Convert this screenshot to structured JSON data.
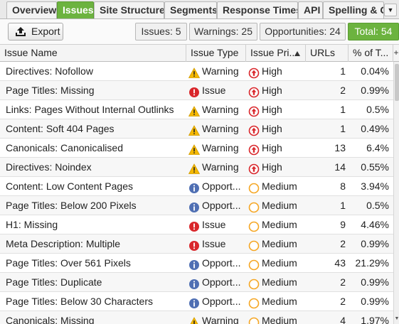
{
  "tabs": [
    {
      "label": "Overview",
      "active": false
    },
    {
      "label": "Issues",
      "active": true
    },
    {
      "label": "Site Structure",
      "active": false
    },
    {
      "label": "Segments",
      "active": false
    },
    {
      "label": "Response Times",
      "active": false
    },
    {
      "label": "API",
      "active": false
    },
    {
      "label": "Spelling & Gr",
      "active": false
    }
  ],
  "toolbar": {
    "export_label": "Export",
    "filters": {
      "issues": "Issues: 5",
      "warnings": "Warnings: 25",
      "opportunities": "Opportunities: 24",
      "total": "Total: 54"
    }
  },
  "table": {
    "headers": [
      "Issue Name",
      "Issue Type",
      "Issue Pri...",
      "URLs",
      "% of T..."
    ],
    "rows": [
      {
        "name": "Directives: Nofollow",
        "type": "Warning",
        "type_icon": "warning-icon",
        "priority": "High",
        "priority_icon": "high-priority-icon",
        "urls": "1",
        "pct": "0.04%"
      },
      {
        "name": "Page Titles: Missing",
        "type": "Issue",
        "type_icon": "issue-icon",
        "priority": "High",
        "priority_icon": "high-priority-icon",
        "urls": "2",
        "pct": "0.99%"
      },
      {
        "name": "Links: Pages Without Internal Outlinks",
        "type": "Warning",
        "type_icon": "warning-icon",
        "priority": "High",
        "priority_icon": "high-priority-icon",
        "urls": "1",
        "pct": "0.5%"
      },
      {
        "name": "Content: Soft 404 Pages",
        "type": "Warning",
        "type_icon": "warning-icon",
        "priority": "High",
        "priority_icon": "high-priority-icon",
        "urls": "1",
        "pct": "0.49%"
      },
      {
        "name": "Canonicals: Canonicalised",
        "type": "Warning",
        "type_icon": "warning-icon",
        "priority": "High",
        "priority_icon": "high-priority-icon",
        "urls": "13",
        "pct": "6.4%"
      },
      {
        "name": "Directives: Noindex",
        "type": "Warning",
        "type_icon": "warning-icon",
        "priority": "High",
        "priority_icon": "high-priority-icon",
        "urls": "14",
        "pct": "0.55%"
      },
      {
        "name": "Content: Low Content Pages",
        "type": "Opport...",
        "type_icon": "opportunity-icon",
        "priority": "Medium",
        "priority_icon": "medium-priority-icon",
        "urls": "8",
        "pct": "3.94%"
      },
      {
        "name": "Page Titles: Below 200 Pixels",
        "type": "Opport...",
        "type_icon": "opportunity-icon",
        "priority": "Medium",
        "priority_icon": "medium-priority-icon",
        "urls": "1",
        "pct": "0.5%"
      },
      {
        "name": "H1: Missing",
        "type": "Issue",
        "type_icon": "issue-icon",
        "priority": "Medium",
        "priority_icon": "medium-priority-icon",
        "urls": "9",
        "pct": "4.46%"
      },
      {
        "name": "Meta Description: Multiple",
        "type": "Issue",
        "type_icon": "issue-icon",
        "priority": "Medium",
        "priority_icon": "medium-priority-icon",
        "urls": "2",
        "pct": "0.99%"
      },
      {
        "name": "Page Titles: Over 561 Pixels",
        "type": "Opport...",
        "type_icon": "opportunity-icon",
        "priority": "Medium",
        "priority_icon": "medium-priority-icon",
        "urls": "43",
        "pct": "21.29%"
      },
      {
        "name": "Page Titles: Duplicate",
        "type": "Opport...",
        "type_icon": "opportunity-icon",
        "priority": "Medium",
        "priority_icon": "medium-priority-icon",
        "urls": "2",
        "pct": "0.99%"
      },
      {
        "name": "Page Titles: Below 30 Characters",
        "type": "Opport...",
        "type_icon": "opportunity-icon",
        "priority": "Medium",
        "priority_icon": "medium-priority-icon",
        "urls": "2",
        "pct": "0.99%"
      },
      {
        "name": "Canonicals: Missing",
        "type": "Warning",
        "type_icon": "warning-icon",
        "priority": "Medium",
        "priority_icon": "medium-priority-icon",
        "urls": "4",
        "pct": "1.97%"
      }
    ]
  },
  "colors": {
    "accent_green": "#6cb33f",
    "warning_yellow": "#f5b800",
    "issue_red": "#d9262b",
    "opportunity_blue": "#4f6fb3",
    "medium_orange": "#f5a623"
  }
}
